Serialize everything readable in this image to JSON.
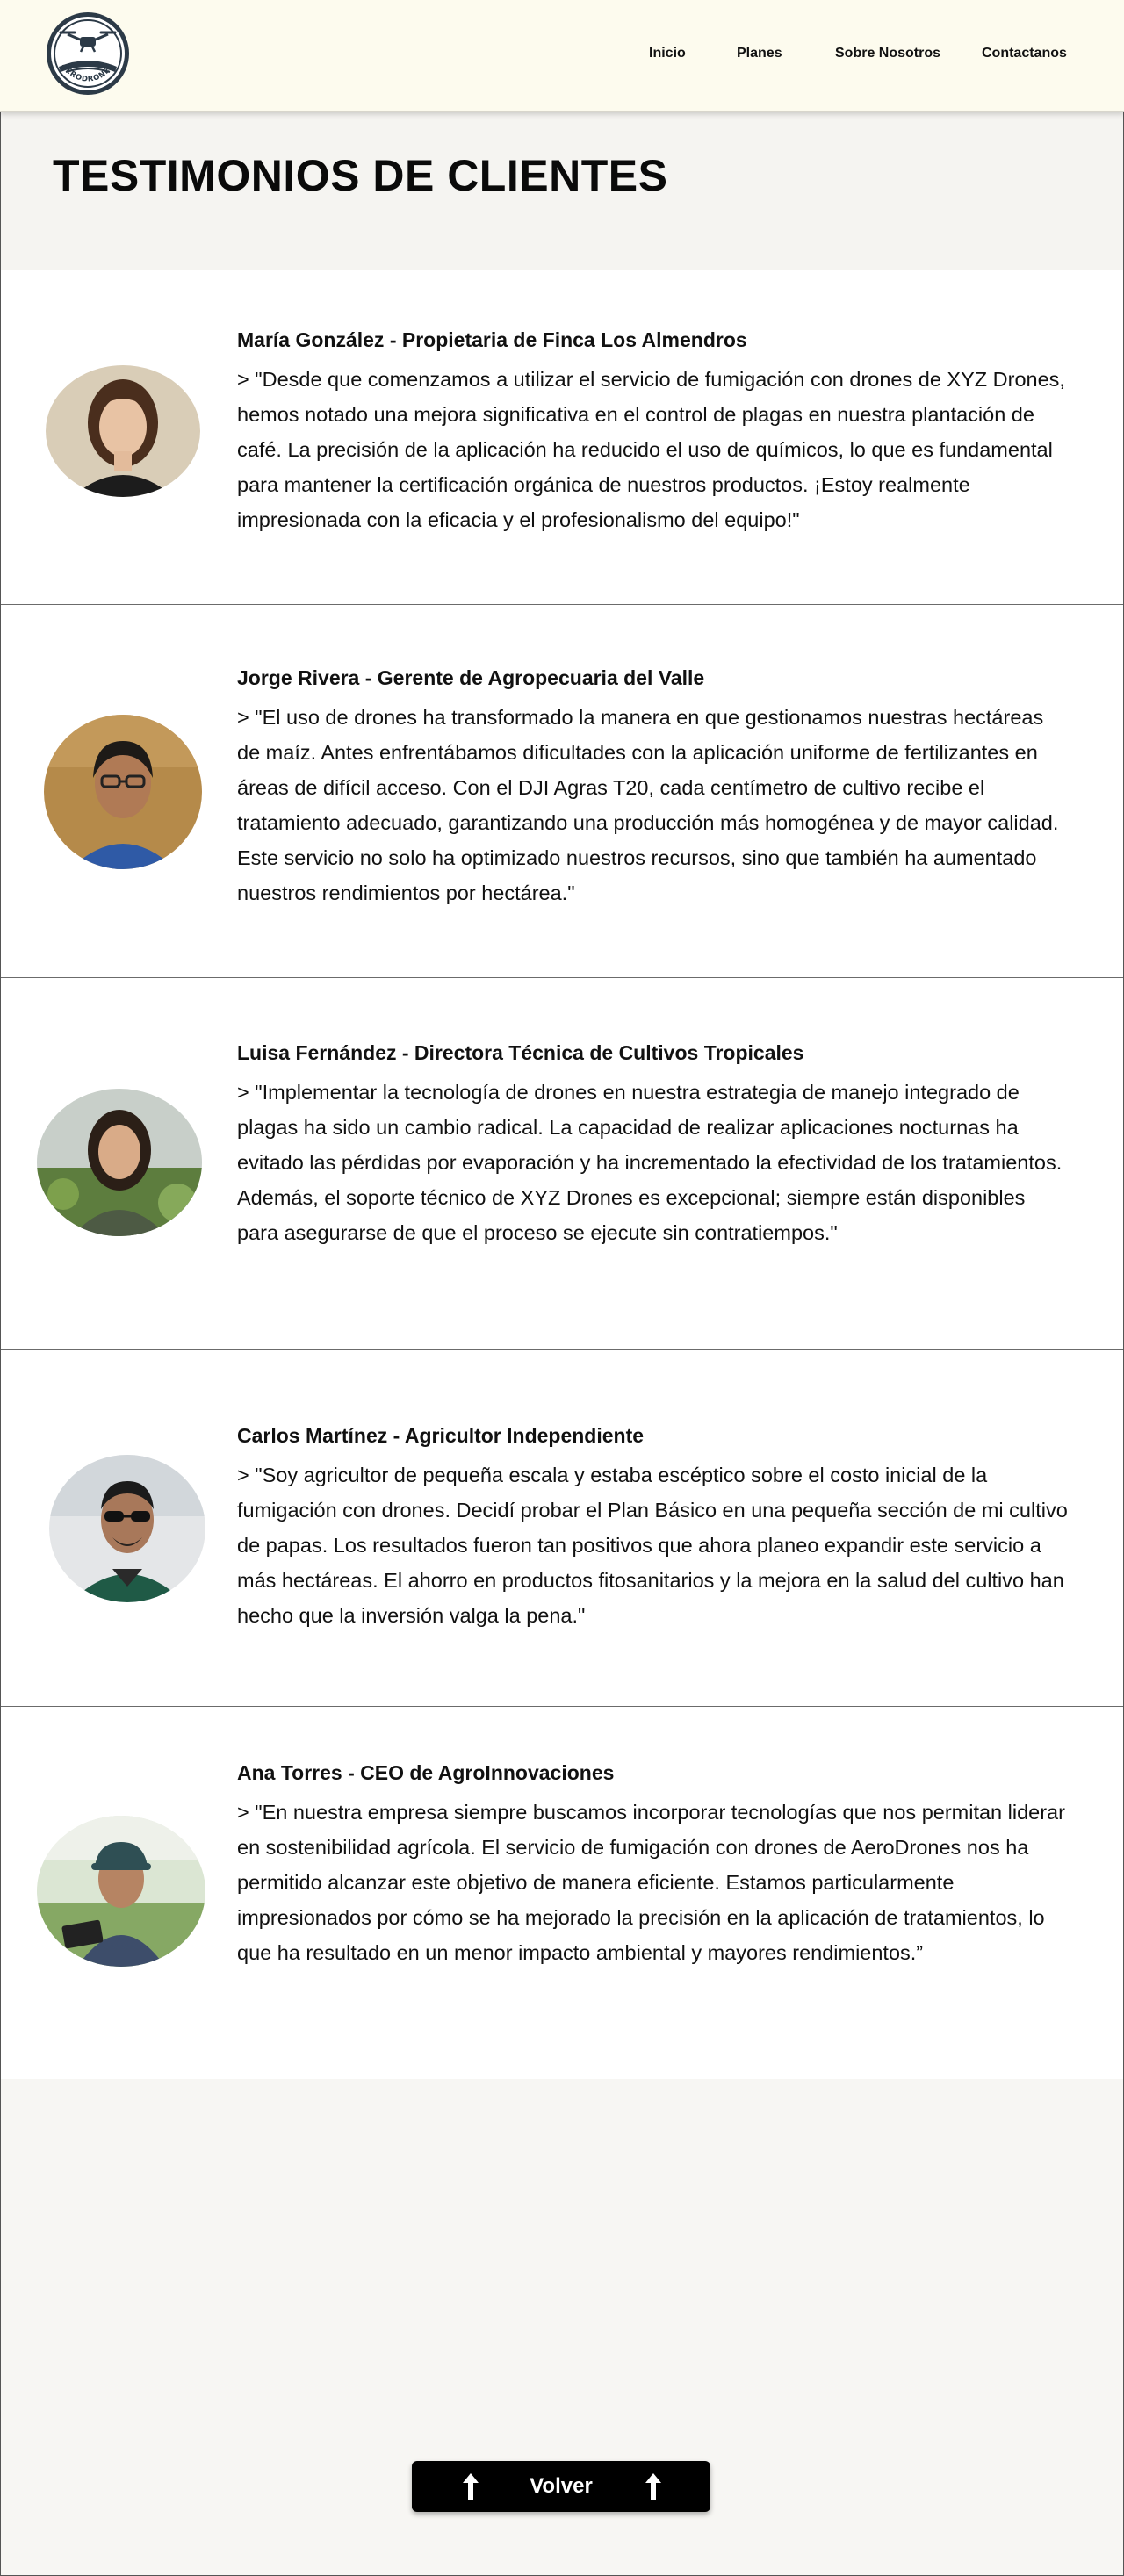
{
  "header": {
    "logo_text": "AERODRONES",
    "nav": [
      {
        "label": "Inicio"
      },
      {
        "label": "Planes"
      },
      {
        "label": "Sobre Nosotros"
      },
      {
        "label": "Contactanos"
      }
    ]
  },
  "title": "TESTIMONIOS DE CLIENTES",
  "testimonials": [
    {
      "name": "María González - Propietaria de Finca Los Almendros",
      "quote": "> \"Desde que comenzamos a utilizar el servicio de fumigación con drones de XYZ Drones, hemos notado una mejora significativa en el control de plagas en nuestra plantación de café. La precisión de la aplicación ha reducido el uso de químicos, lo que es fundamental para mantener la certificación orgánica de nuestros productos. ¡Estoy realmente impresionada con la eficacia y el profesionalismo del equipo!\""
    },
    {
      "name": "Jorge Rivera - Gerente de Agropecuaria del Valle",
      "quote": "> \"El uso de drones ha transformado la manera en que gestionamos nuestras hectáreas de maíz. Antes enfrentábamos dificultades con la aplicación uniforme de fertilizantes en áreas de difícil acceso. Con el DJI Agras T20, cada centímetro de cultivo recibe el tratamiento adecuado, garantizando una producción más homogénea y de mayor calidad. Este servicio no solo ha optimizado nuestros recursos, sino que también ha aumentado nuestros rendimientos por hectárea.\""
    },
    {
      "name": "Luisa Fernández - Directora Técnica de Cultivos Tropicales",
      "quote": "> \"Implementar la tecnología de drones en nuestra estrategia de manejo integrado de plagas ha sido un cambio radical. La capacidad de realizar aplicaciones nocturnas ha evitado las pérdidas por evaporación y ha incrementado la efectividad de los tratamientos. Además, el soporte técnico de XYZ Drones es excepcional; siempre están disponibles para asegurarse de que el proceso se ejecute sin contratiempos.\""
    },
    {
      "name": "Carlos Martínez - Agricultor Independiente",
      "quote": "> \"Soy agricultor de pequeña escala y estaba escéptico sobre el costo inicial de la fumigación con drones. Decidí probar el Plan Básico en una pequeña sección de mi cultivo de papas. Los resultados fueron tan positivos que ahora planeo expandir este servicio a más hectáreas. El ahorro en productos fitosanitarios y la mejora en la salud del cultivo han hecho que la inversión valga la pena.\""
    },
    {
      "name": "Ana Torres - CEO de AgroInnovaciones",
      "quote": "> \"En nuestra empresa siempre buscamos incorporar tecnologías que nos permitan liderar en sostenibilidad agrícola. El servicio de fumigación con drones de AeroDrones nos ha permitido alcanzar este objetivo de manera eficiente. Estamos particularmente impresionados por cómo se ha mejorado la precisión en la aplicación de tratamientos, lo que ha resultado en un menor impacto ambiental y mayores rendimientos.”"
    }
  ],
  "back_button": {
    "label": "Volver",
    "icon": "arrow-up-icon"
  },
  "colors": {
    "header_bg": "#fdfbee",
    "page_bg": "#f7f6f3",
    "card_bg": "#ffffff",
    "button_bg": "#000000"
  }
}
